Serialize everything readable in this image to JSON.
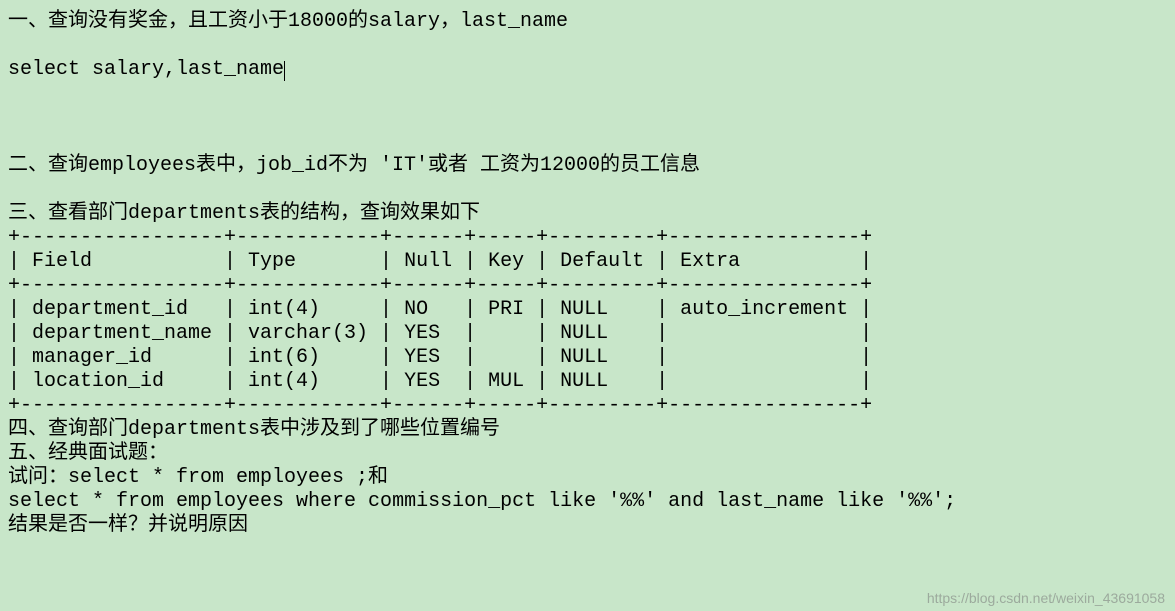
{
  "lines": {
    "q1_title": "一、查询没有奖金，且工资小于18000的salary，last_name",
    "q1_sql": "select salary,last_name",
    "q2_title": "二、查询employees表中，job_id不为 'IT'或者 工资为12000的员工信息",
    "q3_title": "三、查看部门departments表的结构，查询效果如下",
    "tbl_border_top": "+-----------------+------------+------+-----+---------+----------------+",
    "tbl_header": "| Field           | Type       | Null | Key | Default | Extra          |",
    "tbl_border_mid": "+-----------------+------------+------+-----+---------+----------------+",
    "tbl_row1": "| department_id   | int(4)     | NO   | PRI | NULL    | auto_increment |",
    "tbl_row2": "| department_name | varchar(3) | YES  |     | NULL    |                |",
    "tbl_row3": "| manager_id      | int(6)     | YES  |     | NULL    |                |",
    "tbl_row4": "| location_id     | int(4)     | YES  | MUL | NULL    |                |",
    "tbl_border_bot": "+-----------------+------------+------+-----+---------+----------------+",
    "q4_title": "四、查询部门departments表中涉及到了哪些位置编号",
    "q5_title": "五、经典面试题：",
    "q5_line1": "试问：select * from employees ;和",
    "q5_line2": "select * from employees where commission_pct like '%%' and last_name like '%%';",
    "q5_line3": "结果是否一样？并说明原因"
  },
  "watermark": "https://blog.csdn.net/weixin_43691058",
  "chart_data": {
    "type": "table",
    "title": "departments table structure",
    "columns": [
      "Field",
      "Type",
      "Null",
      "Key",
      "Default",
      "Extra"
    ],
    "rows": [
      [
        "department_id",
        "int(4)",
        "NO",
        "PRI",
        "NULL",
        "auto_increment"
      ],
      [
        "department_name",
        "varchar(3)",
        "YES",
        "",
        "NULL",
        ""
      ],
      [
        "manager_id",
        "int(6)",
        "YES",
        "",
        "NULL",
        ""
      ],
      [
        "location_id",
        "int(4)",
        "YES",
        "MUL",
        "NULL",
        ""
      ]
    ]
  }
}
